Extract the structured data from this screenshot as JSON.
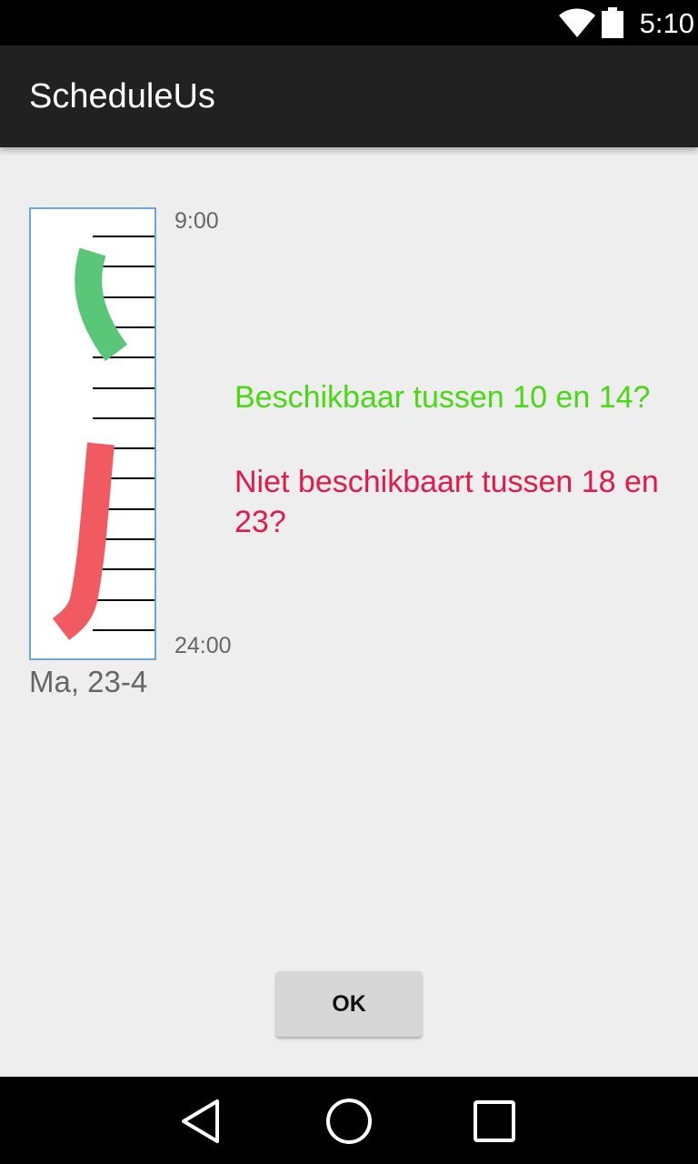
{
  "status_bar": {
    "time": "5:10",
    "icons": [
      "wifi-icon",
      "battery-icon"
    ]
  },
  "app_bar": {
    "title": "ScheduleUs"
  },
  "schedule": {
    "start_time": "9:00",
    "end_time": "24:00",
    "day_label": "Ma, 23-4",
    "hour_marks": 15,
    "available_color": "#5ac678",
    "unavailable_color": "#f25a61"
  },
  "questions": {
    "available": "Beschikbaar tussen 10 en 14?",
    "unavailable": "Niet beschikbaart tussen 18 en 23?",
    "available_color": "#49d812",
    "unavailable_color": "#e2194b"
  },
  "actions": {
    "ok_label": "OK"
  },
  "nav_bar": {
    "icons": [
      "back-icon",
      "home-icon",
      "recent-apps-icon"
    ]
  }
}
